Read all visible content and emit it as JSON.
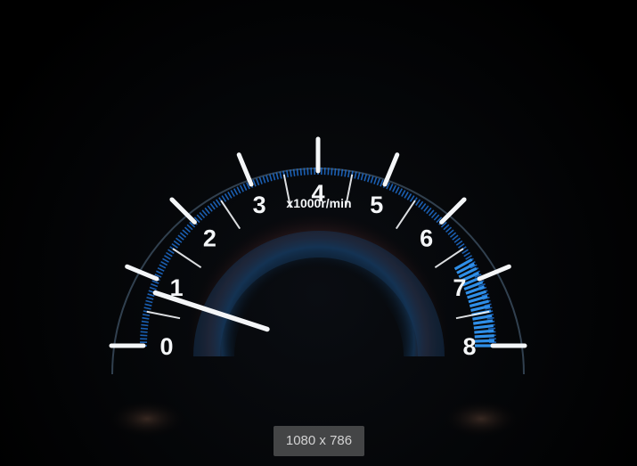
{
  "photo": {
    "subject": "tachometer-gauge",
    "unit_label": "x1000r/min",
    "scale_labels": [
      "0",
      "1",
      "2",
      "3",
      "4",
      "5",
      "6",
      "7",
      "8"
    ],
    "scale_min": 0,
    "scale_max": 8,
    "needle_value": 0.8,
    "redzone_start": 6.7,
    "colors": {
      "background": "#020203",
      "tick": "#f4f6f8",
      "glow": "#1e6fd0",
      "redzone": "#2f8fe8"
    }
  },
  "image_size_badge": "1080 x 786"
}
